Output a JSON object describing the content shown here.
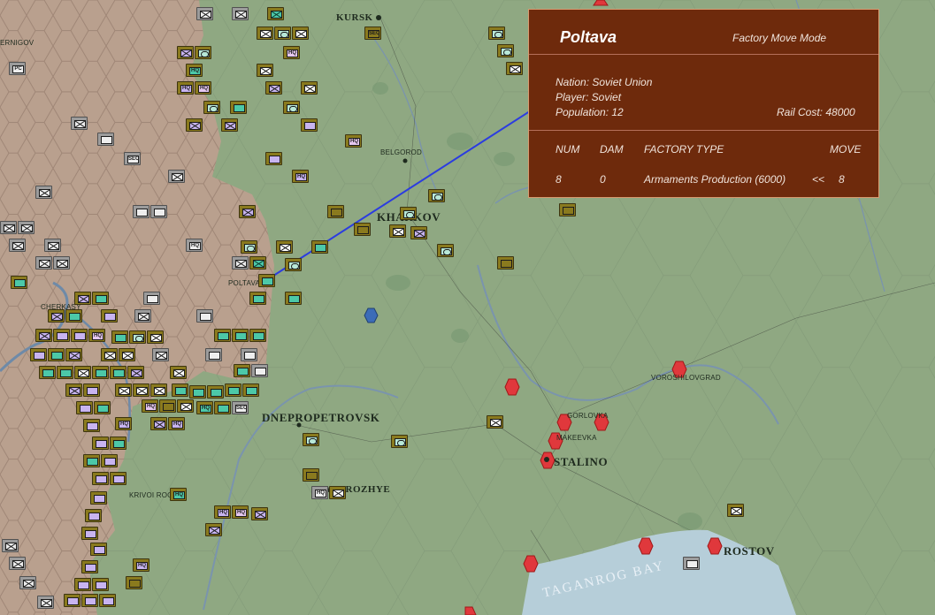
{
  "info_panel": {
    "city": "Poltava",
    "mode": "Factory Move Mode",
    "nation": "Nation: Soviet Union",
    "player": "Player: Soviet",
    "population": "Population: 12",
    "rail_cost": "Rail Cost: 48000",
    "columns": {
      "num": "NUM",
      "dam": "DAM",
      "type": "FACTORY TYPE",
      "move": "MOVE"
    },
    "row": {
      "num": "8",
      "dam": "0",
      "type": "Armaments Production (6000)",
      "arrows": "<<",
      "move": "8"
    }
  },
  "map": {
    "cities": {
      "kursk": "KURSK",
      "belgorod": "BELGOROD",
      "kharkov": "KHARKOV",
      "poltava": "POLTAVA",
      "cherkasy": "CHERKASY",
      "dnepropetrovsk": "DNEPROPETROVSK",
      "zaporozhye": "ZAPOROZHYE",
      "krivoi_rog": "KRIVOI ROG",
      "gorlovka": "GORLOVKA",
      "makeevka": "MAKEEVKA",
      "stalino": "STALINO",
      "voroshilovgrad": "VOROSHILOVGRAD",
      "rostov": "ROSTOV",
      "chernigov": "ERNIGOV"
    },
    "sea": "TAGANROG BAY",
    "unit_labels": {
      "hq": "HQ",
      "sec": "SEC",
      "pc": "PC"
    },
    "colors": {
      "land": "#8fa882",
      "german_hex": "#b9a08e",
      "panel": "#6e2a0c",
      "sea": "#b6ced9",
      "axis_factory": "#e0383c",
      "move_line": "#2b3ce0"
    }
  }
}
